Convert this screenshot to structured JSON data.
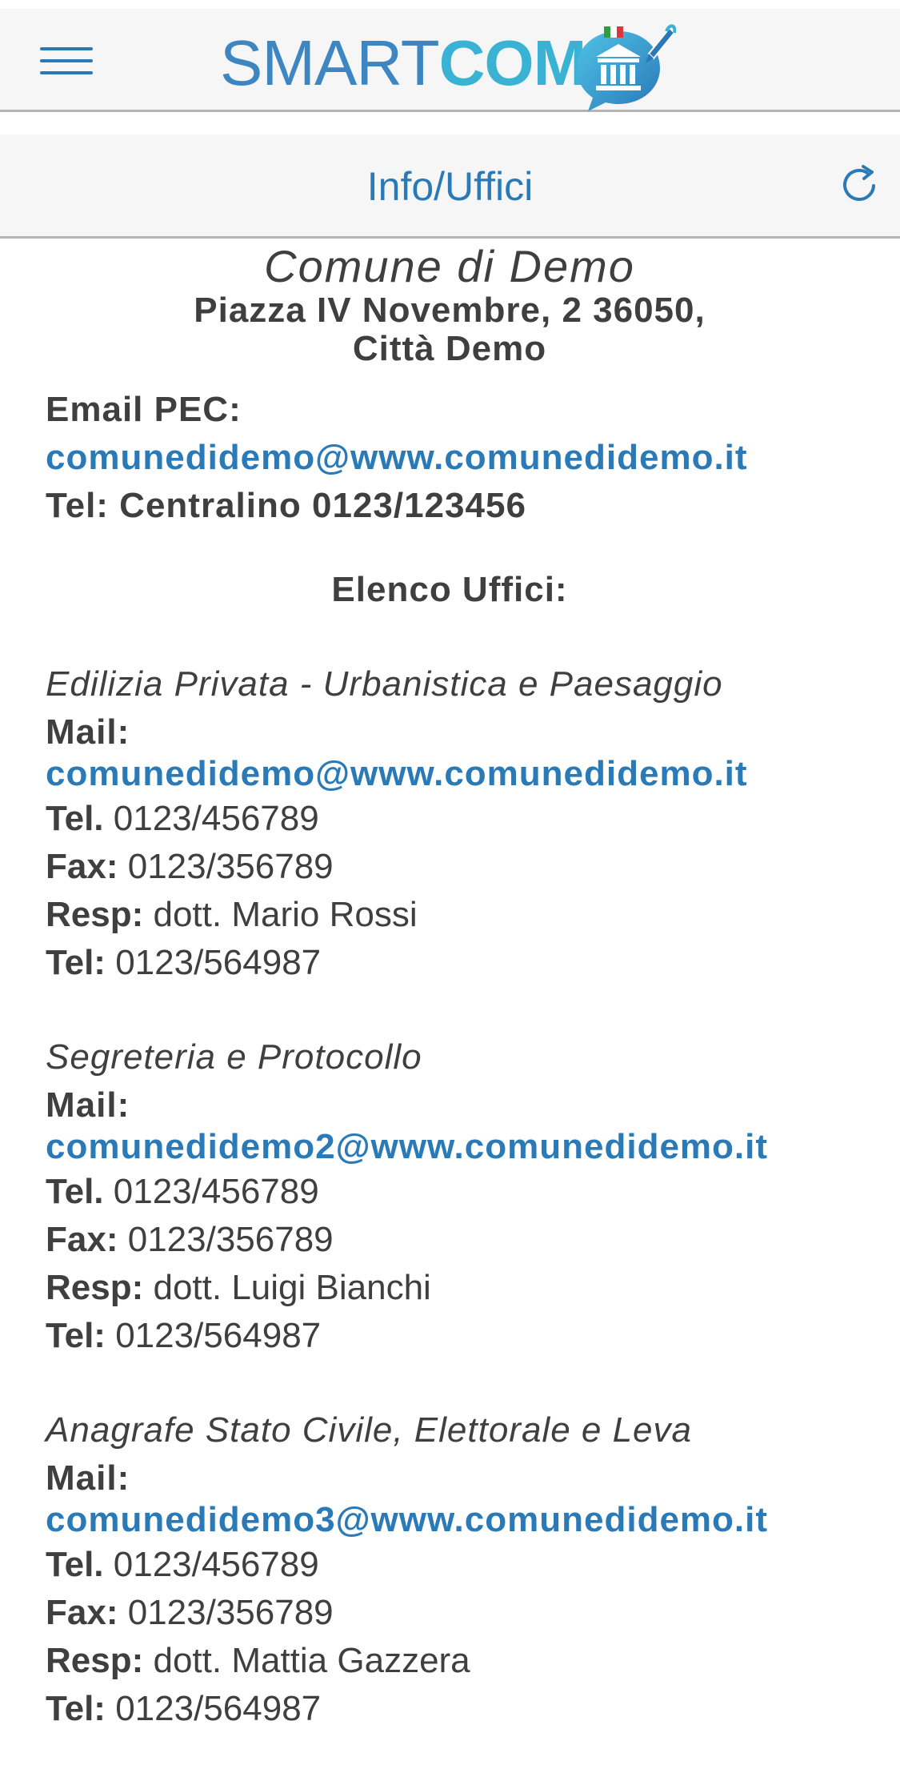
{
  "header": {
    "logo_text_a": "SMART",
    "logo_text_b": "COM",
    "menu_icon": "hamburger-menu-icon"
  },
  "toolbar": {
    "title": "Info/Uffici",
    "refresh_icon": "refresh-icon"
  },
  "town": {
    "name": "Comune di Demo",
    "address_line1": "Piazza IV Novembre, 2 36050,",
    "address_line2": "Città Demo",
    "pec_label": "Email PEC:",
    "pec_email": "comunedidemo@www.comunedidemo.it",
    "phone": "Tel: Centralino 0123/123456"
  },
  "offices_heading": "Elenco Uffici:",
  "offices": [
    {
      "name": "Edilizia Privata - Urbanistica e Paesaggio",
      "mail_label": "Mail:",
      "mail": "comunedidemo@www.comunedidemo.it",
      "tel_label": "Tel.",
      "tel": "0123/456789",
      "fax_label": "Fax:",
      "fax": "0123/356789",
      "resp_label": "Resp:",
      "resp": "dott. Mario Rossi",
      "resp_tel_label": "Tel:",
      "resp_tel": "0123/564987"
    },
    {
      "name": "Segreteria e Protocollo",
      "mail_label": "Mail:",
      "mail": "comunedidemo2@www.comunedidemo.it",
      "tel_label": "Tel.",
      "tel": "0123/456789",
      "fax_label": "Fax:",
      "fax": "0123/356789",
      "resp_label": "Resp:",
      "resp": "dott. Luigi Bianchi",
      "resp_tel_label": "Tel:",
      "resp_tel": "0123/564987"
    },
    {
      "name": "Anagrafe Stato Civile, Elettorale e Leva",
      "mail_label": "Mail:",
      "mail": "comunedidemo3@www.comunedidemo.it",
      "tel_label": "Tel.",
      "tel": "0123/456789",
      "fax_label": "Fax:",
      "fax": "0123/356789",
      "resp_label": "Resp:",
      "resp": "dott. Mattia Gazzera",
      "resp_tel_label": "Tel:",
      "resp_tel": "0123/564987"
    }
  ],
  "colors": {
    "accent": "#2b7ab8",
    "logo_smart": "#3e86c2",
    "logo_com": "#39b2d4",
    "bar_bg": "#f6f6f6",
    "text": "#3f3f3f"
  }
}
